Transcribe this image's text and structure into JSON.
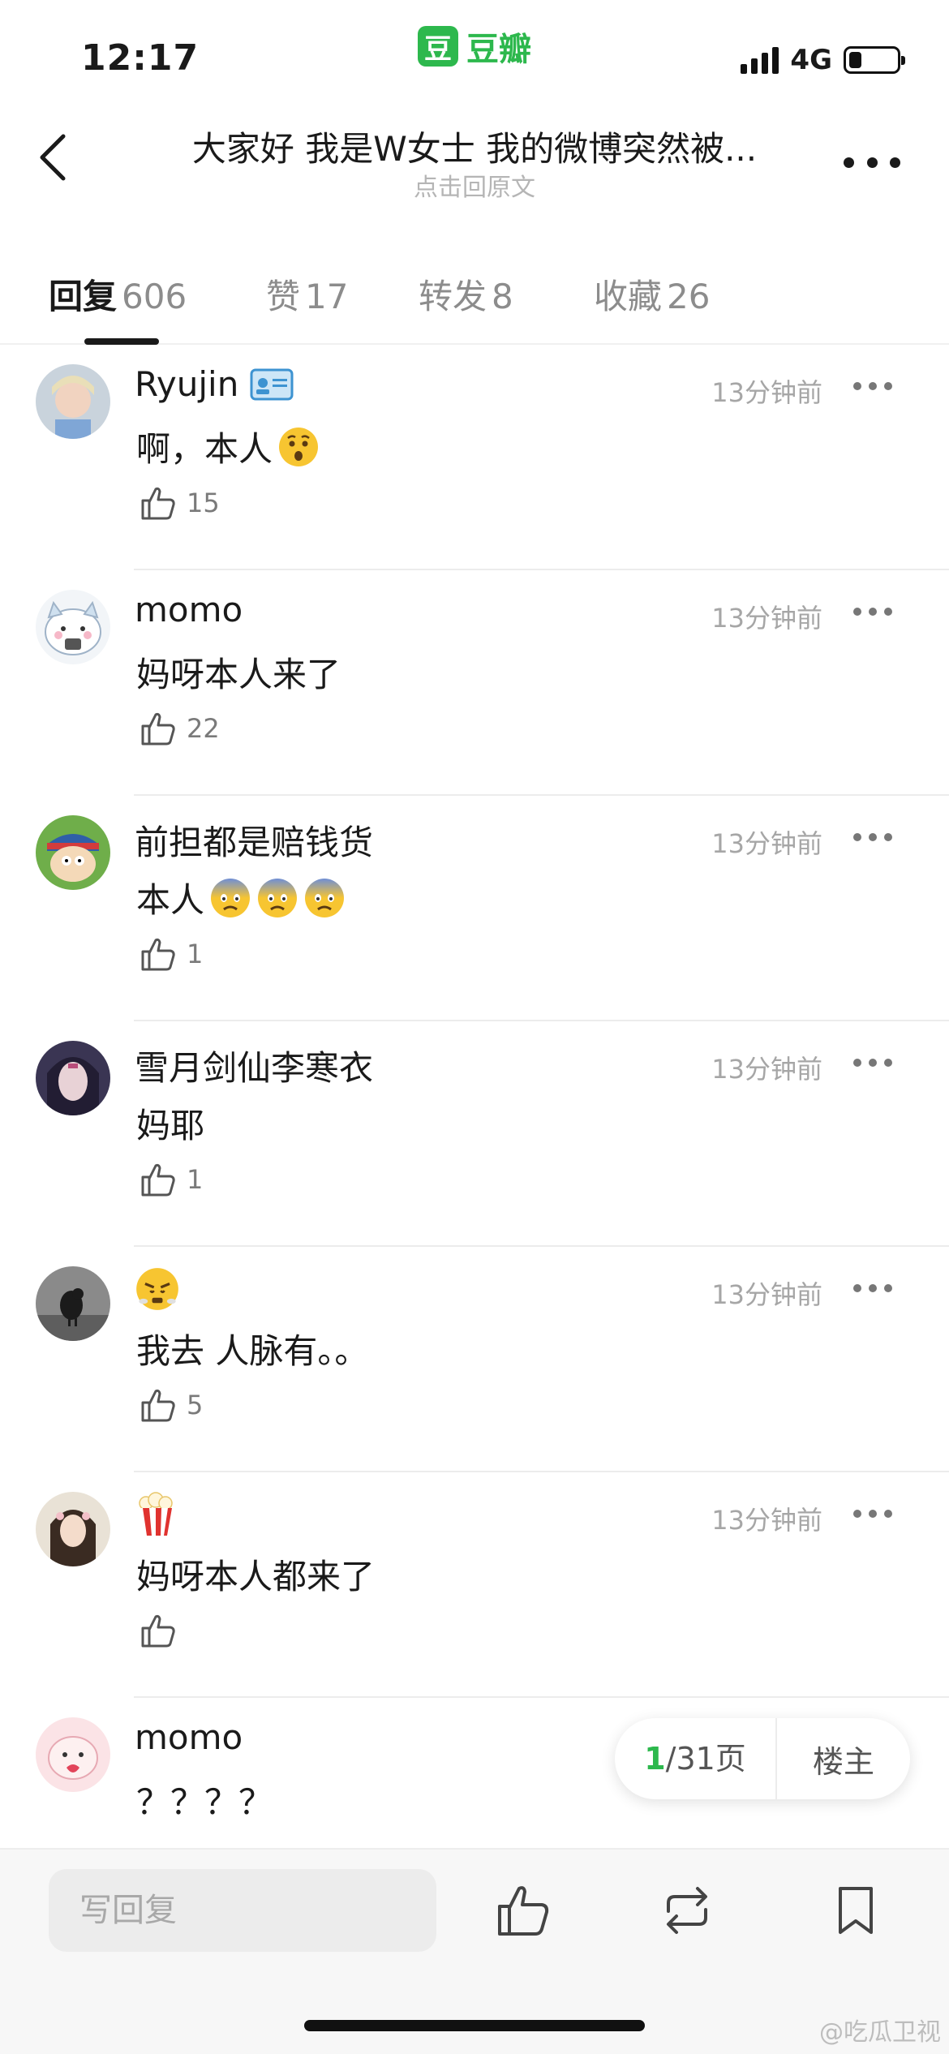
{
  "status_bar": {
    "time": "12:17",
    "app_logo": "豆",
    "app_name": "豆瓣",
    "network": "4G"
  },
  "header": {
    "title": "大家好 我是W女士 我的微博突然被...",
    "subtitle": "点击回原文"
  },
  "tabs": [
    {
      "label": "回复",
      "count": "606",
      "active": true
    },
    {
      "label": "赞",
      "count": "17",
      "active": false
    },
    {
      "label": "转发",
      "count": "8",
      "active": false
    },
    {
      "label": "收藏",
      "count": "26",
      "active": false
    }
  ],
  "comments": [
    {
      "name": "Ryujin",
      "badge": "id-card-badge-icon",
      "time": "13分钟前",
      "text": "啊，本人",
      "text_emojis": [
        "surprised-face-icon"
      ],
      "likes": "15"
    },
    {
      "name": "momo",
      "time": "13分钟前",
      "text": "妈呀本人来了",
      "likes": "22"
    },
    {
      "name": "前担都是赔钱货",
      "time": "13分钟前",
      "text": "本人",
      "text_emojis": [
        "fearful-face-icon",
        "fearful-face-icon",
        "fearful-face-icon"
      ],
      "likes": "1"
    },
    {
      "name": "雪月剑仙李寒衣",
      "time": "13分钟前",
      "text": "妈耶",
      "likes": "1"
    },
    {
      "name_icon": "huffing-face-icon",
      "time": "13分钟前",
      "text": "我去 人脉有。。",
      "likes": "5"
    },
    {
      "name_icon": "popcorn-icon",
      "time": "13分钟前",
      "text": "妈呀本人都来了",
      "likes": ""
    },
    {
      "name": "momo",
      "time": "",
      "text": "？？？？",
      "likes": ""
    }
  ],
  "pager": {
    "current": "1",
    "total": "/31页",
    "owner_label": "楼主"
  },
  "bottom_bar": {
    "reply_placeholder": "写回复",
    "watermark": "@吃瓜卫视"
  },
  "colors": {
    "brand_green": "#2db84d",
    "divider": "#ececec",
    "secondary_text": "#a6a6a6"
  }
}
